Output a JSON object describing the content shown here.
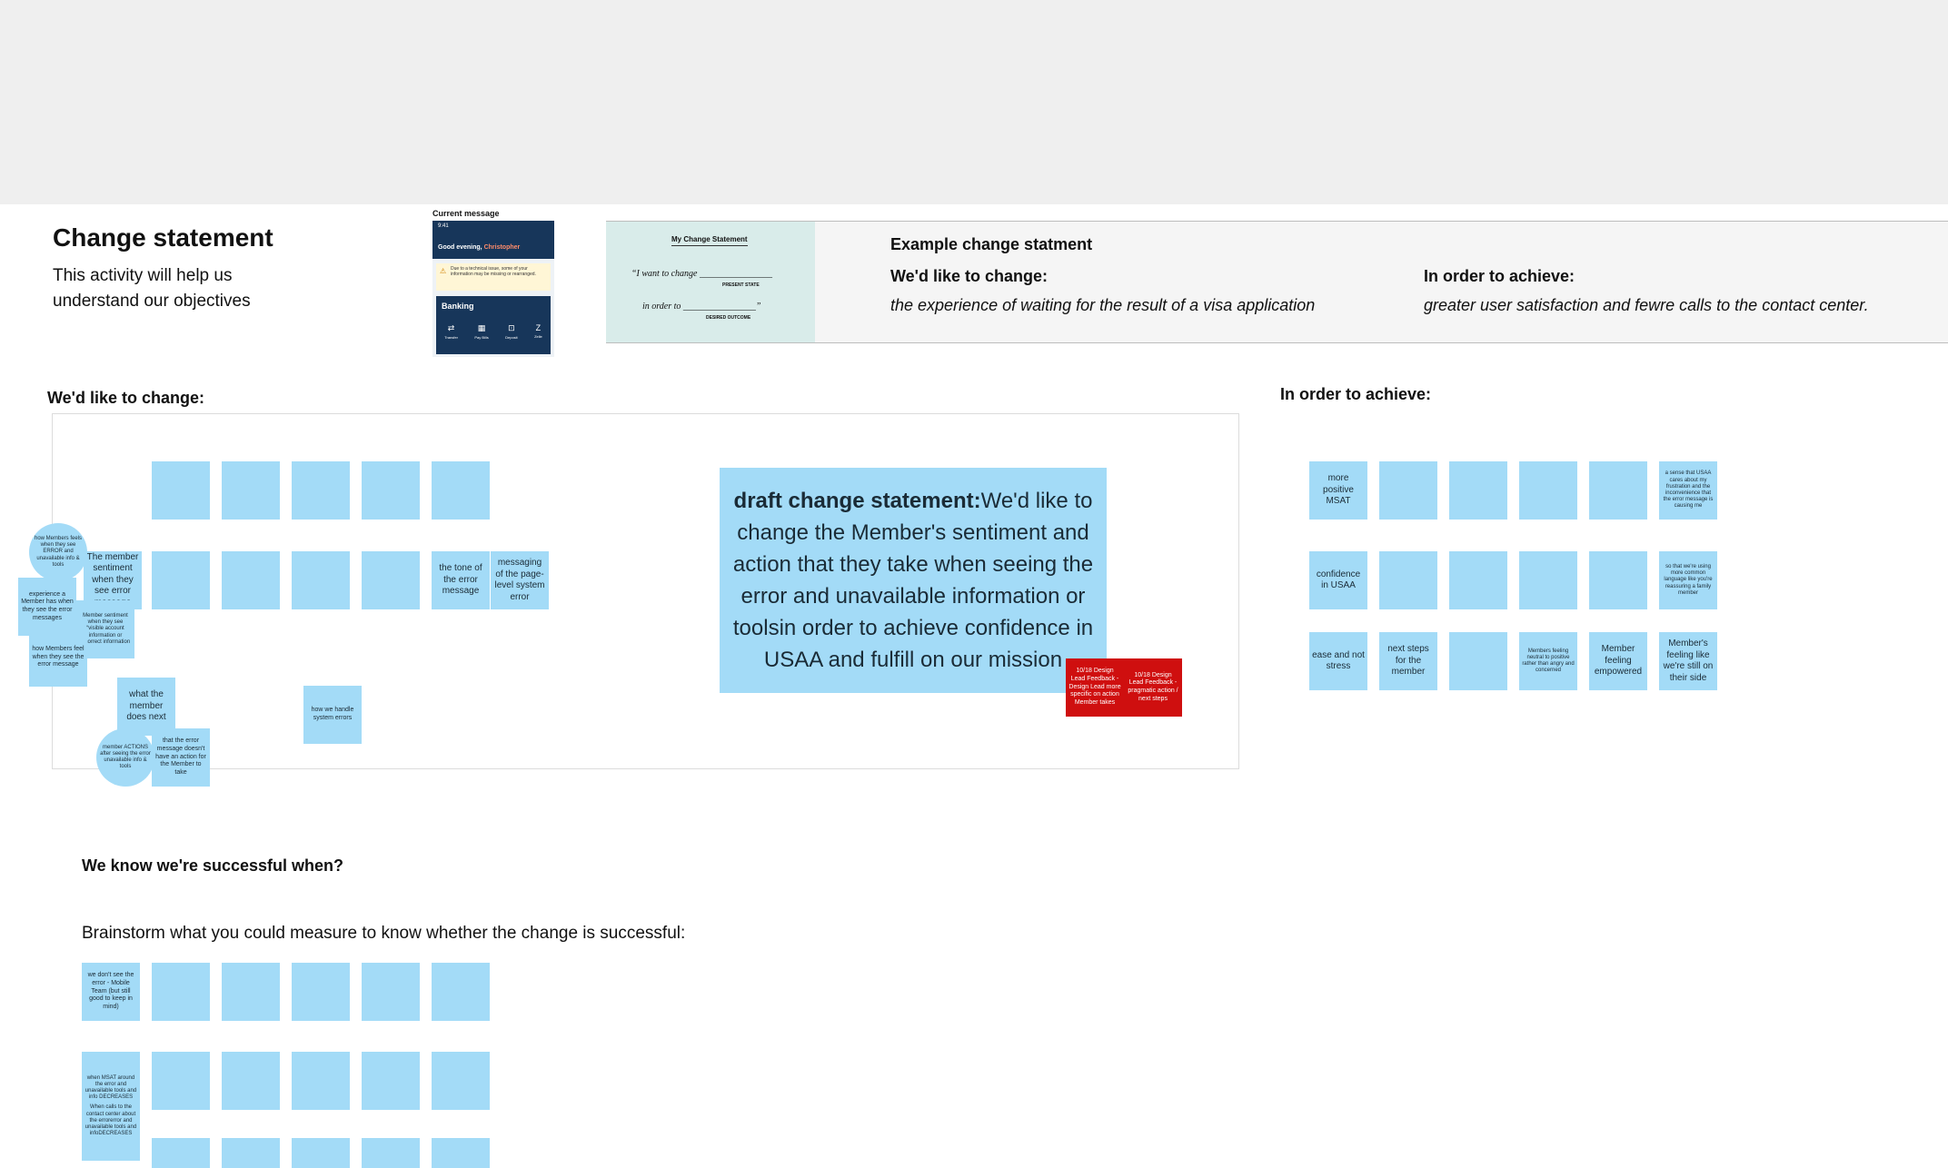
{
  "header": {
    "title": "Change statement",
    "subtitle": "This activity will help us understand our objectives"
  },
  "current_message": {
    "label": "Current message",
    "time": "9:41",
    "greeting": "Good evening, ",
    "greeting_name": "Christopher",
    "alert_text": "Due to a technical issue, some of your information may be missing or rearranged.",
    "banking_title": "Banking",
    "actions": [
      "Transfer",
      "Pay Bills",
      "Deposit",
      "Zelle"
    ]
  },
  "example": {
    "card_heading": "My Change Statement",
    "card_line1": "“I want to change ________________",
    "card_line1_sub": "PRESENT STATE",
    "card_line2": "in order to ________________”",
    "card_line2_sub": "DESIRED OUTCOME",
    "title": "Example change statment",
    "change_heading": "We'd like to change:",
    "change_text": "the experience of waiting for the result of a visa application",
    "achieve_heading": "In order to achieve:",
    "achieve_text": "greater user satisfaction and fewre calls to the contact center."
  },
  "change_section": {
    "label": "We'd like to change:",
    "notes": [
      "how Members feels when they see ERROR and unavailable info & tools",
      "The member sentiment when they see error message",
      "experience a Member has when they see the error messages",
      "Member sentiment when they see “visible account information or incorrect information",
      "how Members feel when they see the error message",
      "the tone of the error message",
      "messaging of the page-level system error",
      "what the member does next",
      "member ACTIONS after seeing the error unavailable info & tools",
      "that the error message doesn't have an action for the Member to take",
      "how we handle system errors"
    ],
    "draft_bold": "draft change statement:",
    "draft_text": "We'd like to change the Member's sentiment and action that they take when seeing the error and unavailable information or toolsin order to achieve confidence in USAA and fulfill on our mission",
    "feedback1": "10/18 Design Lead Feedback - Design Lead more specific on action Member takes",
    "feedback2": "10/18 Design Lead Feedback -pragmatic action / next steps"
  },
  "achieve_section": {
    "label": "In order to achieve:",
    "notes": [
      "more positive MSAT",
      "a sense that USAA cares about my frustration and the inconvenience that the error message is causing me",
      "confidence in USAA",
      "so that we're using more common language like you're reassuring a family member",
      "ease and not stress",
      "next steps for the member",
      "Members feeling neutral to positive rather than angry and concerned",
      "Member feeling empowered",
      "Member's feeling like we're still on their side"
    ]
  },
  "success_section": {
    "label": "We know we're successful when?",
    "prompt": "Brainstorm what you could measure to know whether the change is successful:",
    "notes": [
      "we don't see the error - Mobile Team (but still good to keep in mind)",
      "when MSAT around the error and unavailable tools and info DECREASES",
      "When calls to the contact center about the errorerror and unavailable tools and infoDECREASES"
    ]
  }
}
